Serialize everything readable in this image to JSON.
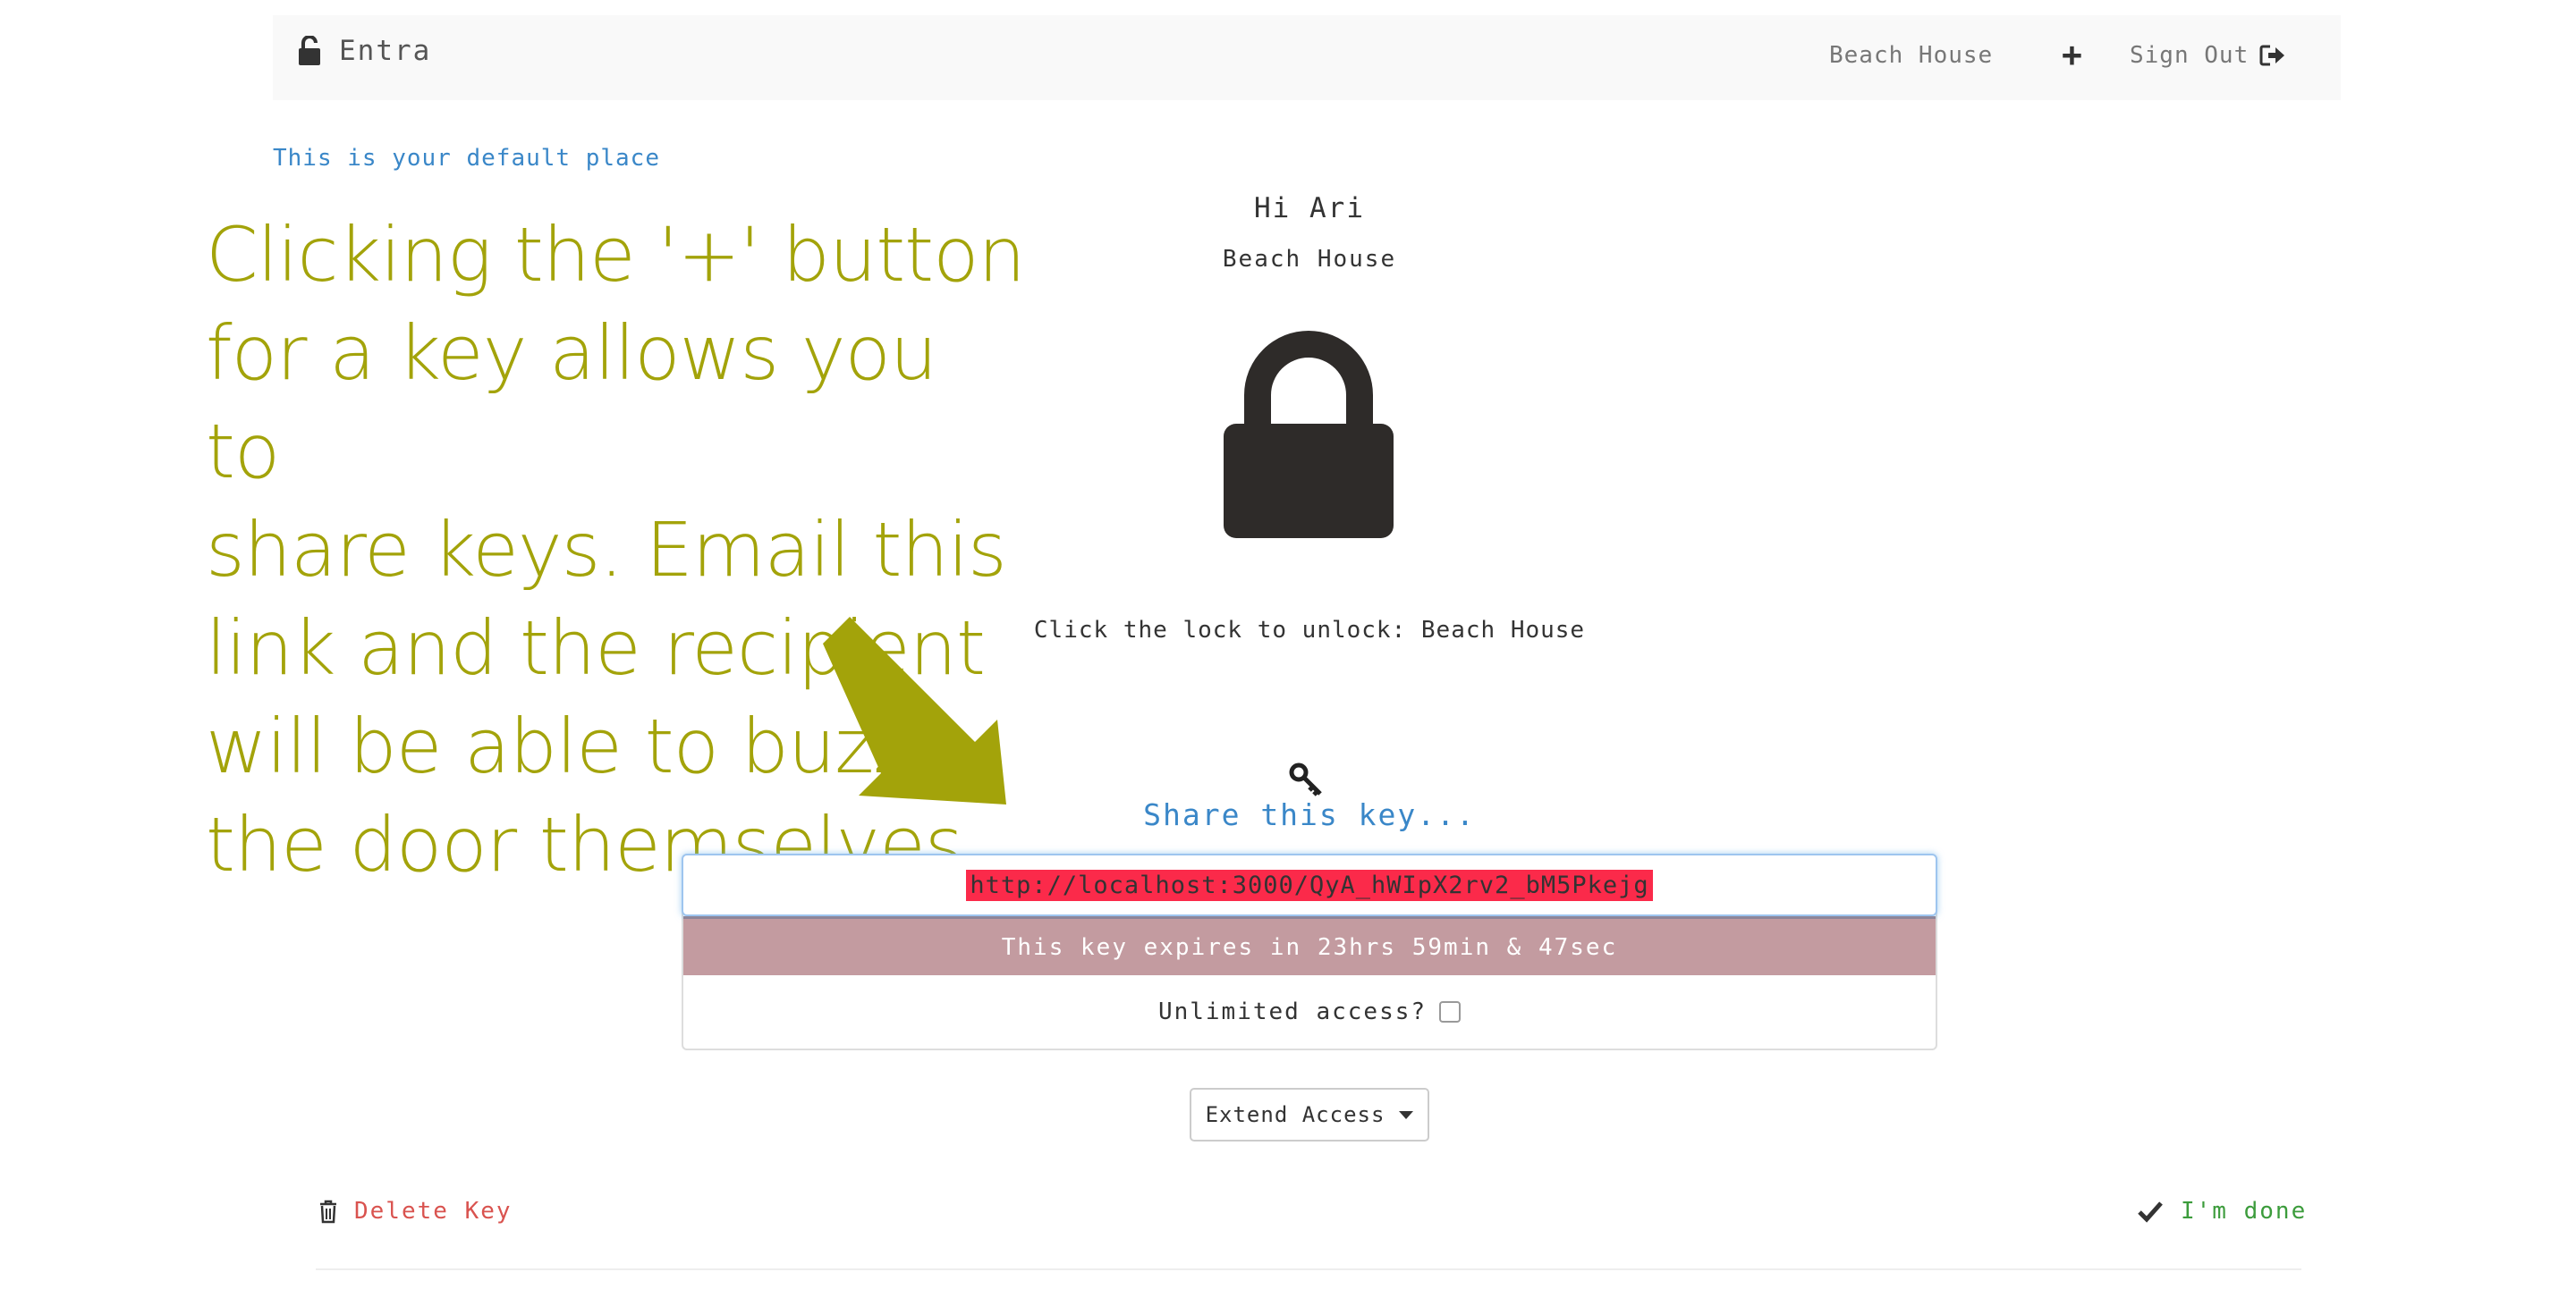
{
  "navbar": {
    "brand": "Entra",
    "brand_icon": "unlock-icon",
    "place": "Beach House",
    "add_label": "+",
    "sign_out": "Sign Out",
    "sign_out_icon": "sign-out-icon"
  },
  "default_place_text": "This is your default place",
  "annotation": {
    "lines": [
      "Clicking the '+' button",
      "for a key allows you to",
      "share keys.  Email this",
      "link and the recipient",
      "will be able to buzz",
      "the door themselves"
    ],
    "color": "#a3a30a"
  },
  "greeting": {
    "hi": "Hi Ari",
    "place": "Beach House"
  },
  "lock_icon": "lock-icon",
  "click_lock_text": "Click the lock to unlock: Beach House",
  "share": {
    "icon": "key-icon",
    "heading": "Share this key...",
    "link": "http://localhost:3000/QyA_hWIpX2rv2_bM5Pkejg",
    "expires": "This key expires in 23hrs 59min & 47sec",
    "unlimited_label": "Unlimited access?",
    "unlimited_checked": false
  },
  "extend_access": "Extend Access",
  "actions": {
    "delete": "Delete Key",
    "delete_icon": "trash-icon",
    "done": "I'm done",
    "done_icon": "check-icon"
  },
  "colors": {
    "link_blue": "#3a87c8",
    "link_highlight": "#fb2a4a",
    "expires_bg": "#c39ba0",
    "delete_red": "#d9534f",
    "done_green": "#3c9c3c"
  }
}
